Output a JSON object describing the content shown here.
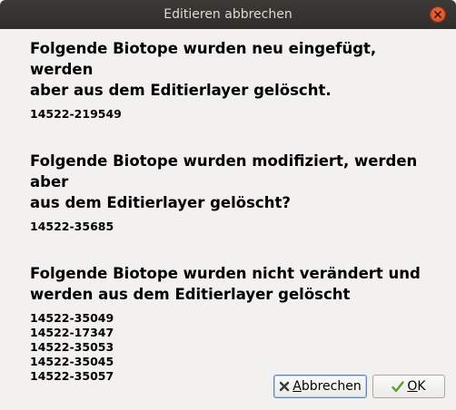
{
  "window": {
    "title": "Editieren abbrechen"
  },
  "sections": [
    {
      "heading": "Folgende Biotope wurden neu eingefügt, werden aber aus dem Editierlayer gelöscht.",
      "heading_lines": [
        "Folgende Biotope wurden neu eingefügt, werden",
        "aber aus dem Editierlayer gelöscht."
      ],
      "ids": [
        "14522-219549"
      ]
    },
    {
      "heading": "Folgende Biotope wurden modifiziert, werden aber aus dem Editierlayer gelöscht?",
      "heading_lines": [
        "Folgende Biotope wurden modifiziert, werden aber",
        "aus dem Editierlayer gelöscht?"
      ],
      "ids": [
        "14522-35685"
      ]
    },
    {
      "heading": "Folgende Biotope wurden nicht verändert und werden aus dem Editierlayer gelöscht",
      "heading_lines": [
        "Folgende Biotope wurden nicht verändert und",
        "werden aus dem Editierlayer gelöscht"
      ],
      "ids": [
        "14522-35049",
        "14522-17347",
        "14522-35053",
        "14522-35045",
        "14522-35057"
      ]
    }
  ],
  "buttons": {
    "cancel": {
      "mnemonic": "A",
      "rest": "bbrechen",
      "icon": "cross-icon"
    },
    "ok": {
      "mnemonic": "O",
      "rest": "K",
      "icon": "checkmark-icon"
    }
  },
  "colors": {
    "titlebar": "#2f2e2b",
    "close": "#e0582f",
    "background": "#f2f1f0",
    "cancel_icon": "#3a3a3a",
    "ok_icon": "#5aa02c"
  }
}
